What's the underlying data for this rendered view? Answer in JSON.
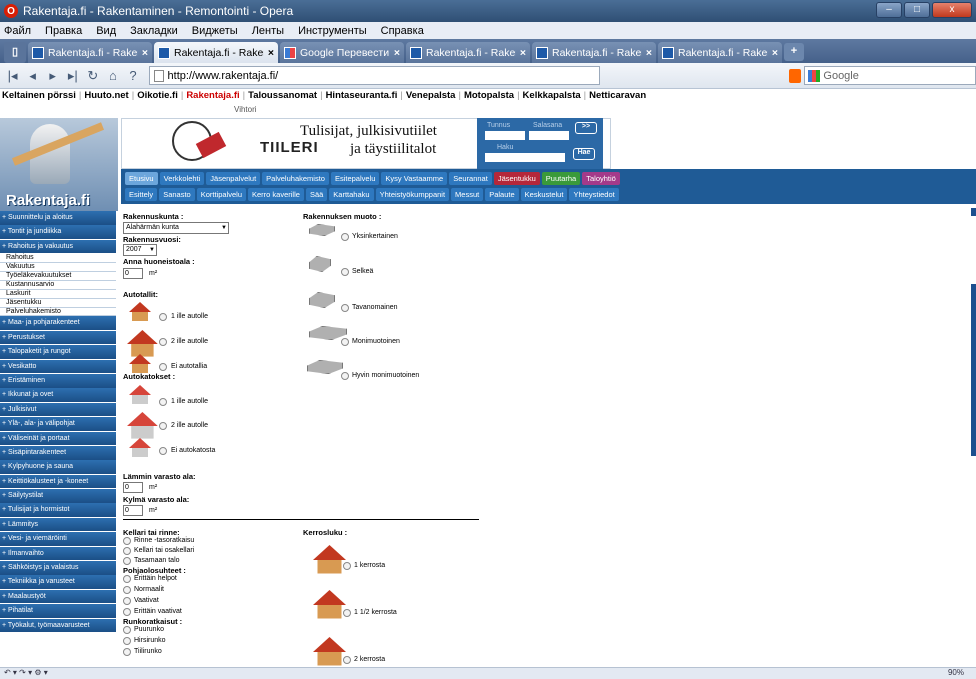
{
  "window": {
    "title": "Rakentaja.fi - Rakentaminen - Remontointi - Opera",
    "min": "–",
    "max": "□",
    "close": "x"
  },
  "menu": [
    "Файл",
    "Правка",
    "Вид",
    "Закладки",
    "Виджеты",
    "Ленты",
    "Инструменты",
    "Справка"
  ],
  "tabs": [
    {
      "label": "Rakentaja.fi - Rakenta...",
      "active": false,
      "icon": "site-icon"
    },
    {
      "label": "Rakentaja.fi - Rakenta...",
      "active": true,
      "icon": "site-icon"
    },
    {
      "label": "Google Перевести",
      "active": false,
      "icon": "google-icon"
    },
    {
      "label": "Rakentaja.fi - Rakenta...",
      "active": false,
      "icon": "site-icon"
    },
    {
      "label": "Rakentaja.fi - Rakenta...",
      "active": false,
      "icon": "site-icon"
    },
    {
      "label": "Rakentaja.fi - Rakenta...",
      "active": false,
      "icon": "site-icon"
    }
  ],
  "newtab": "+",
  "address": {
    "url": "http://www.rakentaja.fi/"
  },
  "search": {
    "placeholder": "Google"
  },
  "links": [
    "Keltainen pörssi",
    "Huuto.net",
    "Oikotie.fi",
    "Rakentaja.fi",
    "Taloussanomat",
    "Hintaseuranta.fi",
    "Venepalsta",
    "Motopalsta",
    "Kelkkapalsta",
    "Netticaravan"
  ],
  "vihtori": "Vihtori",
  "logo": "Rakentaja.fi",
  "banner": {
    "brand": "TIILERI",
    "line1": "Tulisijat, julkisivutiilet",
    "line2": "ja täystiilitalot"
  },
  "login": {
    "user_label": "Tunnus",
    "pass_label": "Salasana",
    "go": ">>",
    "search_label": "Haku",
    "search_btn": "Hae"
  },
  "nav1": [
    {
      "label": "Etusivu",
      "cls": "on"
    },
    {
      "label": "Verkkolehti"
    },
    {
      "label": "Jäsenpalvelut"
    },
    {
      "label": "Palveluhakemisto"
    },
    {
      "label": "Esitepalvelu"
    },
    {
      "label": "Kysy Vastaamme"
    },
    {
      "label": "Seurannat"
    },
    {
      "label": "Jäsentukku",
      "cls": "c-red"
    },
    {
      "label": "Puutarha",
      "cls": "c-grn"
    },
    {
      "label": "Taloyhtiö",
      "cls": "c-mag"
    }
  ],
  "nav2": [
    "Esittely",
    "Sanasto",
    "Korttipalvelu",
    "Kerro kaverille",
    "Sää",
    "Karttahaku",
    "Yhteistyökumppanit",
    "Messut",
    "Palaute",
    "Keskustelut",
    "Yhteystiedot"
  ],
  "sidebar": [
    {
      "label": "+ Suunnittelu ja aloitus"
    },
    {
      "label": "+ Tontit ja jundiikka"
    },
    {
      "label": "+ Rahoitus ja vakuutus"
    },
    {
      "label": "Rahoitus",
      "sub": true
    },
    {
      "label": "Vakuutus",
      "sub": true
    },
    {
      "label": "Työeläkevakuutukset",
      "sub": true
    },
    {
      "label": "Kustannusarvio",
      "sub": true
    },
    {
      "label": "Laskurit",
      "sub": true
    },
    {
      "label": "Jäsentukku",
      "sub": true
    },
    {
      "label": "Palveluhakemisto",
      "sub": true
    },
    {
      "label": "+ Maa- ja pohjarakenteet"
    },
    {
      "label": "+ Perustukset"
    },
    {
      "label": "+ Talopaketit ja rungot"
    },
    {
      "label": "+ Vesikatto"
    },
    {
      "label": "+ Eristäminen"
    },
    {
      "label": "+ Ikkunat ja ovet"
    },
    {
      "label": "+ Julkisivut"
    },
    {
      "label": "+ Ylä-, ala- ja välipohjat"
    },
    {
      "label": "+ Väliseinät ja portaat"
    },
    {
      "label": "+ Sisäpintarakenteet"
    },
    {
      "label": "+ Kylpyhuone ja sauna"
    },
    {
      "label": "+ Keittiökalusteet ja -koneet"
    },
    {
      "label": "+ Säilytystilat"
    },
    {
      "label": "+ Tulisijat ja hormistot"
    },
    {
      "label": "+ Lämmitys"
    },
    {
      "label": "+ Vesi- ja viemäröinti"
    },
    {
      "label": "+ Ilmanvaihto"
    },
    {
      "label": "+ Sähköistys ja valaistus"
    },
    {
      "label": "+ Tekniikka ja varusteet"
    },
    {
      "label": "+ Maalaustyöt"
    },
    {
      "label": "+ Pihatilat"
    },
    {
      "label": "+ Työkalut, työmaavarusteet"
    }
  ],
  "form": {
    "kunta_label": "Rakennuskunta :",
    "kunta_value": "Alahärmän kunta",
    "vuosi_label": "Rakennusvuosi:",
    "vuosi_value": "2007",
    "ala_label": "Anna huoneistoala :",
    "ala_value": "0",
    "unit": "m²",
    "autotallit_label": "Autotallit:",
    "autotallit": [
      "1 ille autolle",
      "2 ille autolle",
      "Ei autotallia"
    ],
    "autokatokset_label": "Autokatokset :",
    "autokatokset": [
      "1 ille autolle",
      "2 ille autolle",
      "Ei autokatosta"
    ],
    "lammin_label": "Lämmin varasto ala:",
    "lammin_value": "0",
    "kylma_label": "Kylmä varasto ala:",
    "kylma_value": "0",
    "muoto_label": "Rakennuksen muoto :",
    "muoto": [
      "Yksinkertainen",
      "Selkeä",
      "Tavanomainen",
      "Monimuotoinen",
      "Hyvin monimuotoinen"
    ],
    "kellari_label": "Kellari tai rinne:",
    "kellari": [
      "Rinne -tasoratkaisu",
      "Kellari tai osakellari",
      "Tasamaan talo"
    ],
    "pohja_label": "Pohjaolosuhteet :",
    "pohja": [
      "Erittäin helpot",
      "Normaalit",
      "Vaativat",
      "Erittäin vaativat"
    ],
    "runko_label": "Runkoratkaisut :",
    "runko": [
      "Puurunko",
      "Hirsirunko",
      "Tiilirunko"
    ],
    "kerros_label": "Kerrosluku :",
    "kerros": [
      "1 kerrosta",
      "1 1/2 kerrosta",
      "2 kerrosta"
    ]
  },
  "status": {
    "left": "↶ ▾  ↷ ▾  ⚙ ▾",
    "zoom": "90%"
  }
}
